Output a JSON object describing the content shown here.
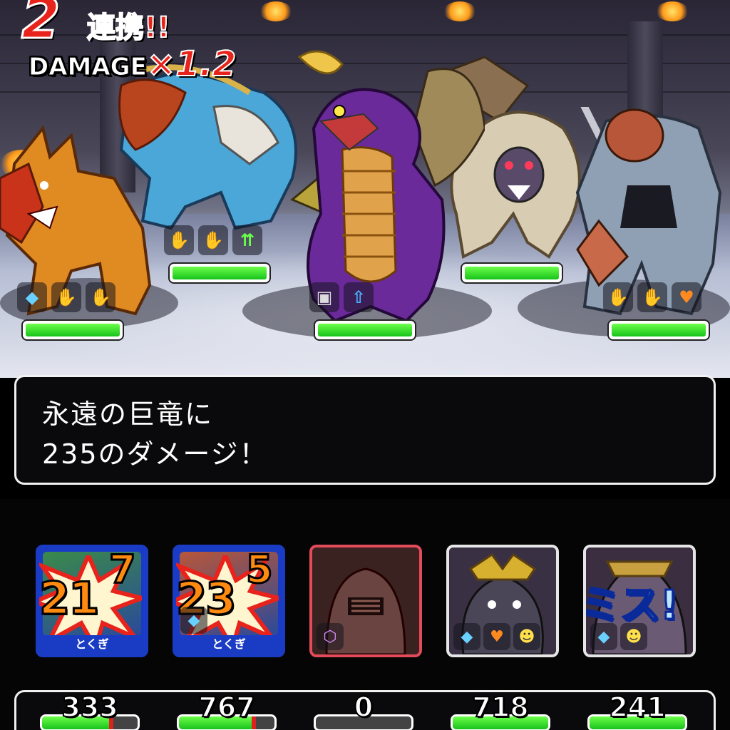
{
  "combo": {
    "count": "2",
    "label": "連携!!",
    "damage_label": "DAMAGE",
    "multiplier": "×1.2"
  },
  "message": {
    "line1": "永遠の巨竜に",
    "line2": "235のダメージ！"
  },
  "enemies": [
    {
      "name": "orange-beast",
      "hp_fraction": 1.0
    },
    {
      "name": "blue-lion-beast",
      "hp_fraction": 1.0
    },
    {
      "name": "purple-dragon",
      "hp_fraction": 1.0
    },
    {
      "name": "white-ape",
      "hp_fraction": 1.0
    },
    {
      "name": "armored-ogre",
      "hp_fraction": 1.0
    }
  ],
  "party": [
    {
      "damage_main": "21",
      "damage_last": "7",
      "tokugi": "とくぎ",
      "hp": "333",
      "hp_fraction": 0.72
    },
    {
      "damage_main": "23",
      "damage_last": "5",
      "tokugi": "とくぎ",
      "hp": "767",
      "hp_fraction": 0.78
    },
    {
      "hp": "0",
      "hp_fraction": 0.0
    },
    {
      "hp": "718",
      "hp_fraction": 1.0
    },
    {
      "miss": "ミス!",
      "hp": "241",
      "hp_fraction": 1.0
    }
  ],
  "colors": {
    "accent_red": "#e8231b",
    "hp_green": "#18c21a",
    "card_blue": "#1a3cc4",
    "dead_border": "#e34a5a"
  }
}
